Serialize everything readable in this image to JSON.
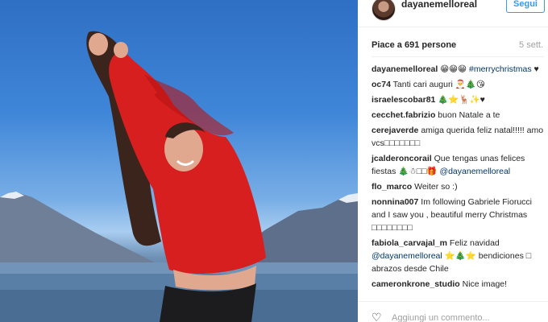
{
  "post": {
    "username": "dayanemelloreal",
    "follow_label": "Segui",
    "likes_text": "Piace a 691 persone",
    "age_text": "5 sett.",
    "comments": [
      {
        "user": "dayanemelloreal",
        "text": "😁😁😁",
        "link": "#merrychristmas",
        "after": "♥"
      },
      {
        "user": "oc74",
        "text": "Tanti cari auguri 🎅🎄😘",
        "link": "",
        "after": ""
      },
      {
        "user": "israelescobar81",
        "text": "🎄⭐🦌✨♥",
        "link": "",
        "after": ""
      },
      {
        "user": "cecchet.fabrizio",
        "text": "buon Natale a te",
        "link": "",
        "after": ""
      },
      {
        "user": "cerejaverde",
        "text": "amiga querida feliz natal!!!!! amo vcs□□□□□□□",
        "link": "",
        "after": ""
      },
      {
        "user": "jcalderoncorail",
        "text": "Que tengas unas felices fiestas 🎄☃□□🎁",
        "link": "@dayanemelloreal",
        "after": ""
      },
      {
        "user": "flo_marco",
        "text": "Weiter so :)",
        "link": "",
        "after": ""
      },
      {
        "user": "nonnina007",
        "text": "Im following Gabriele Fiorucci and I saw you , beautiful merry Christmas □□□□□□□□",
        "link": "",
        "after": ""
      },
      {
        "user": "fabiola_carvajal_m",
        "text": "Feliz navidad",
        "link": "@dayanemelloreal",
        "after": "⭐🎄⭐ bendiciones □ abrazos desde Chile"
      },
      {
        "user": "cameronkrone_studio",
        "text": "Nice image!",
        "link": "",
        "after": ""
      }
    ],
    "add_comment_placeholder": "Aggiungi un commento..."
  }
}
